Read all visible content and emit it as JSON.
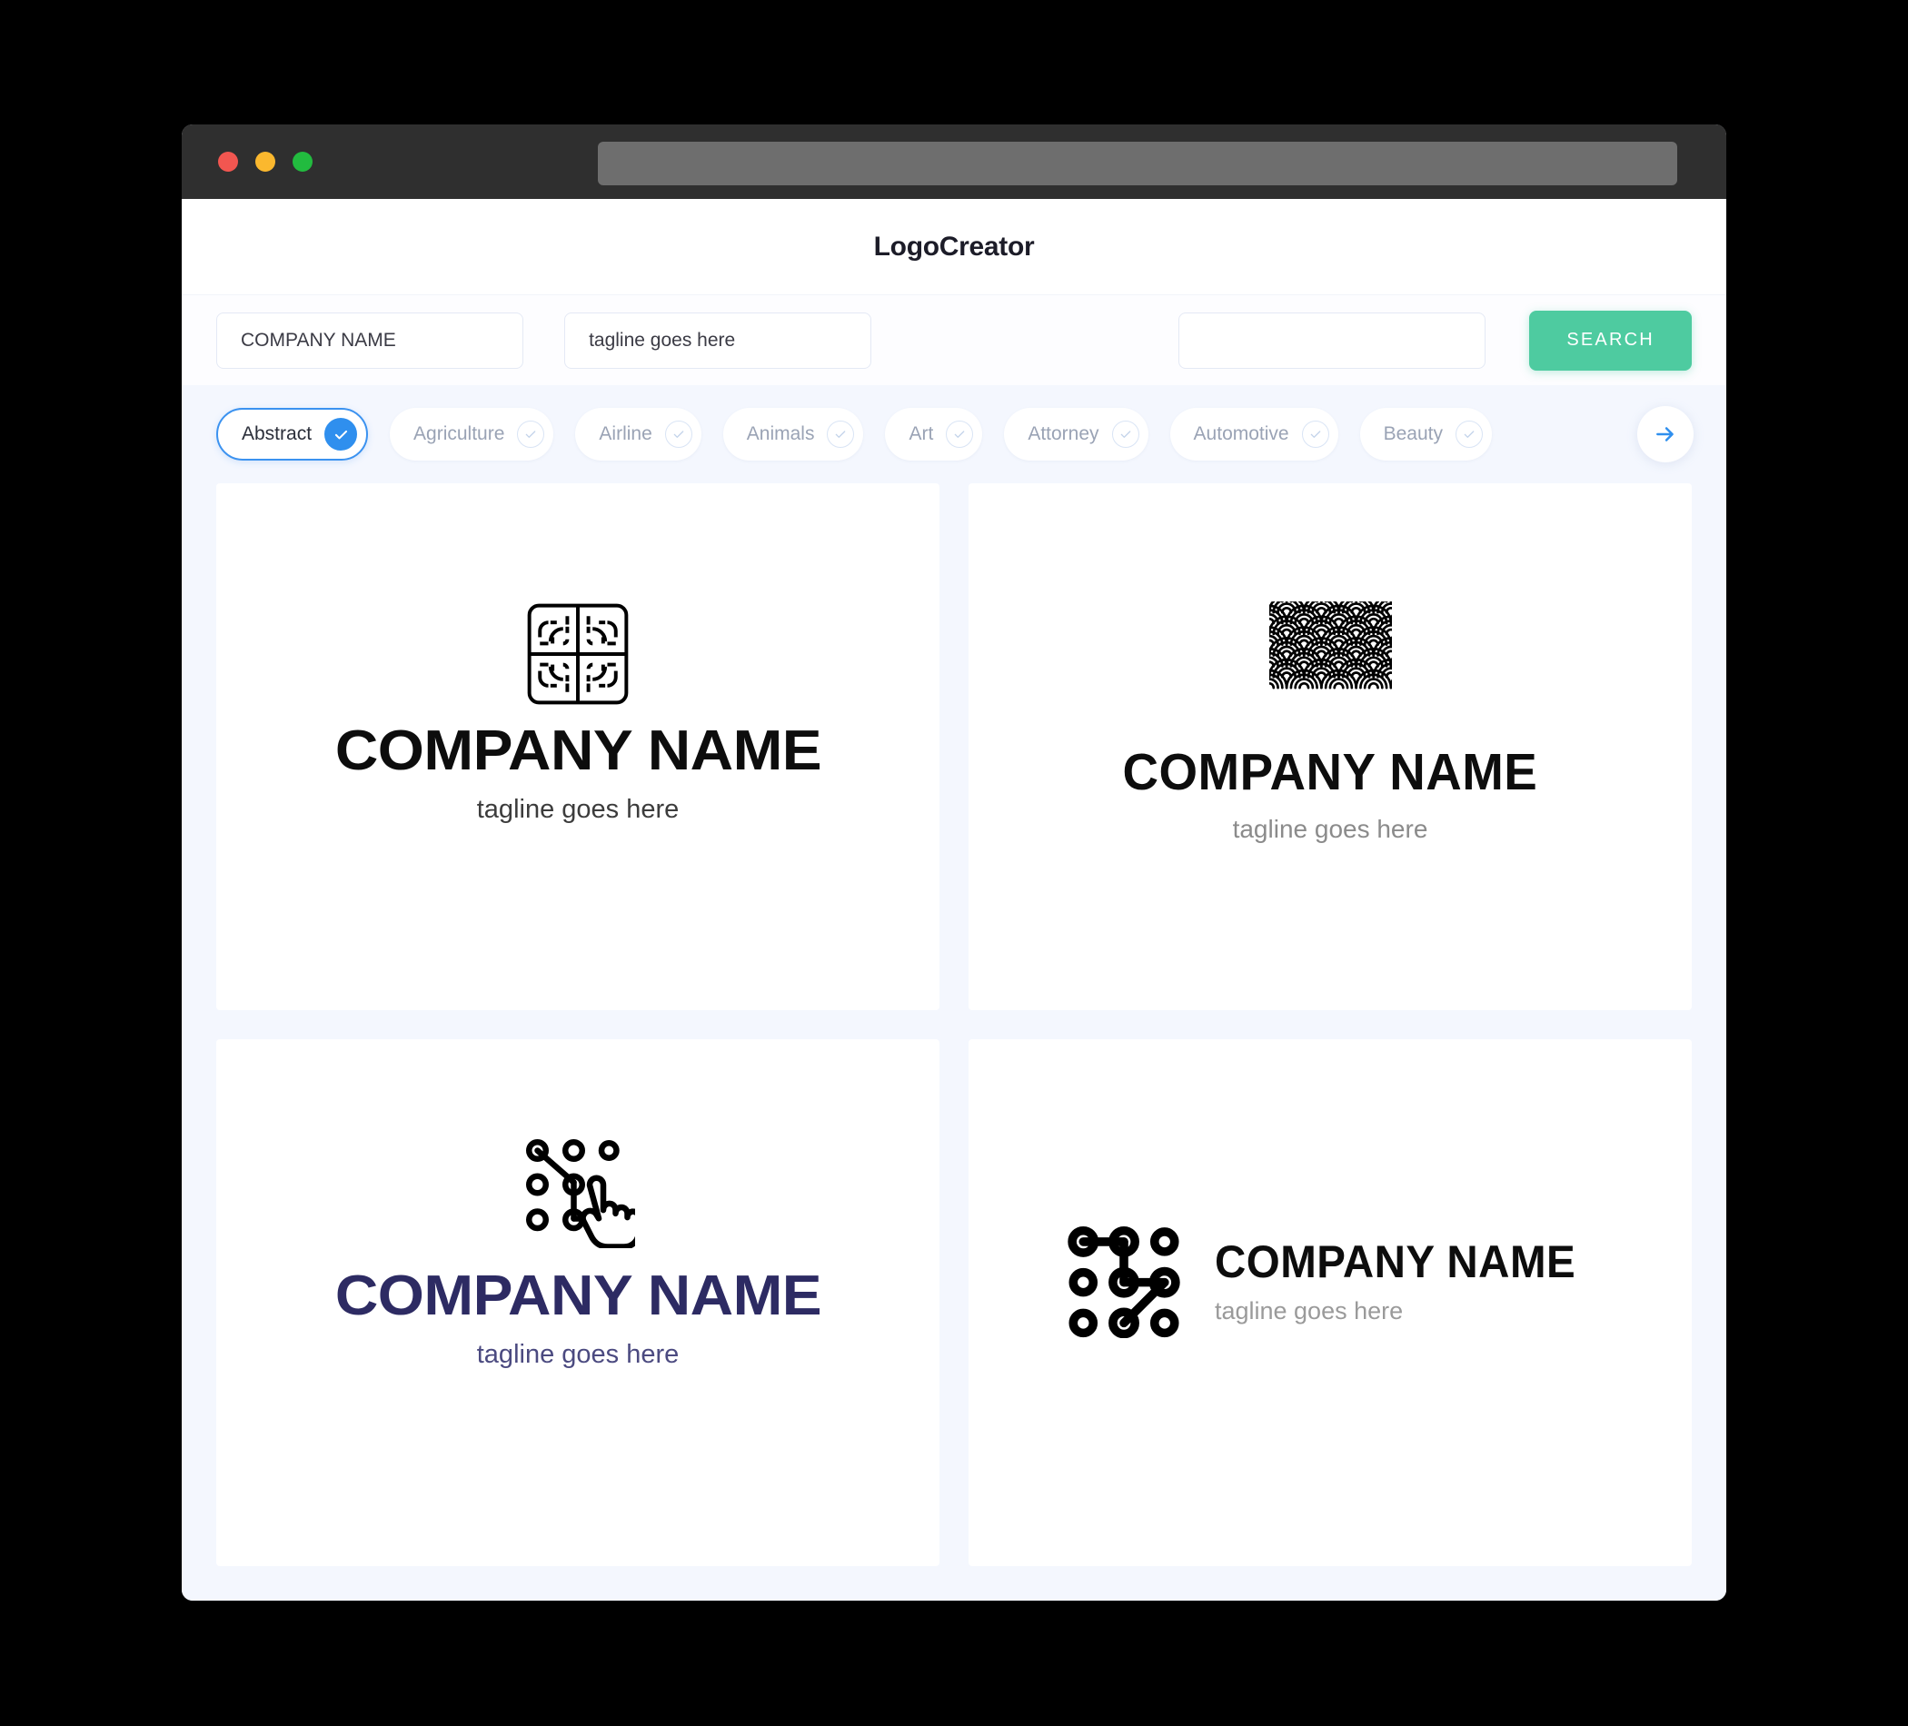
{
  "window": {
    "traffic_lights": [
      "close",
      "minimize",
      "maximize"
    ],
    "url_value": ""
  },
  "header": {
    "title": "LogoCreator"
  },
  "search": {
    "company_value": "COMPANY NAME",
    "tagline_value": "tagline goes here",
    "extra_value": "",
    "search_label": "SEARCH"
  },
  "categories": {
    "items": [
      {
        "label": "Abstract",
        "active": true
      },
      {
        "label": "Agriculture",
        "active": false
      },
      {
        "label": "Airline",
        "active": false
      },
      {
        "label": "Animals",
        "active": false
      },
      {
        "label": "Art",
        "active": false
      },
      {
        "label": "Attorney",
        "active": false
      },
      {
        "label": "Automotive",
        "active": false
      },
      {
        "label": "Beauty",
        "active": false
      }
    ],
    "next_icon": "arrow-right-icon"
  },
  "results": [
    {
      "mark": "maze-square-icon",
      "name": "COMPANY NAME",
      "tagline": "tagline goes here",
      "name_color": "#0d0d0d",
      "tagline_color": "#3c3c3c"
    },
    {
      "mark": "seigaiha-wave-icon",
      "name": "COMPANY NAME",
      "tagline": "tagline goes here",
      "name_color": "#0d0d0d",
      "tagline_color": "#8b8b8b"
    },
    {
      "mark": "dot-grid-cursor-icon",
      "name": "COMPANY NAME",
      "tagline": "tagline goes here",
      "name_color": "#2d2b63",
      "tagline_color": "#4b4a80"
    },
    {
      "mark": "unlock-pattern-icon",
      "name": "COMPANY NAME",
      "tagline": "tagline goes here",
      "name_color": "#0d0d0d",
      "tagline_color": "#9a9a9a"
    }
  ],
  "colors": {
    "accent_blue": "#2f8fee",
    "accent_green": "#4ecba0",
    "page_bg": "#f4f7fe",
    "chrome_bg": "#2f2f2f",
    "navy": "#2d2b63"
  }
}
